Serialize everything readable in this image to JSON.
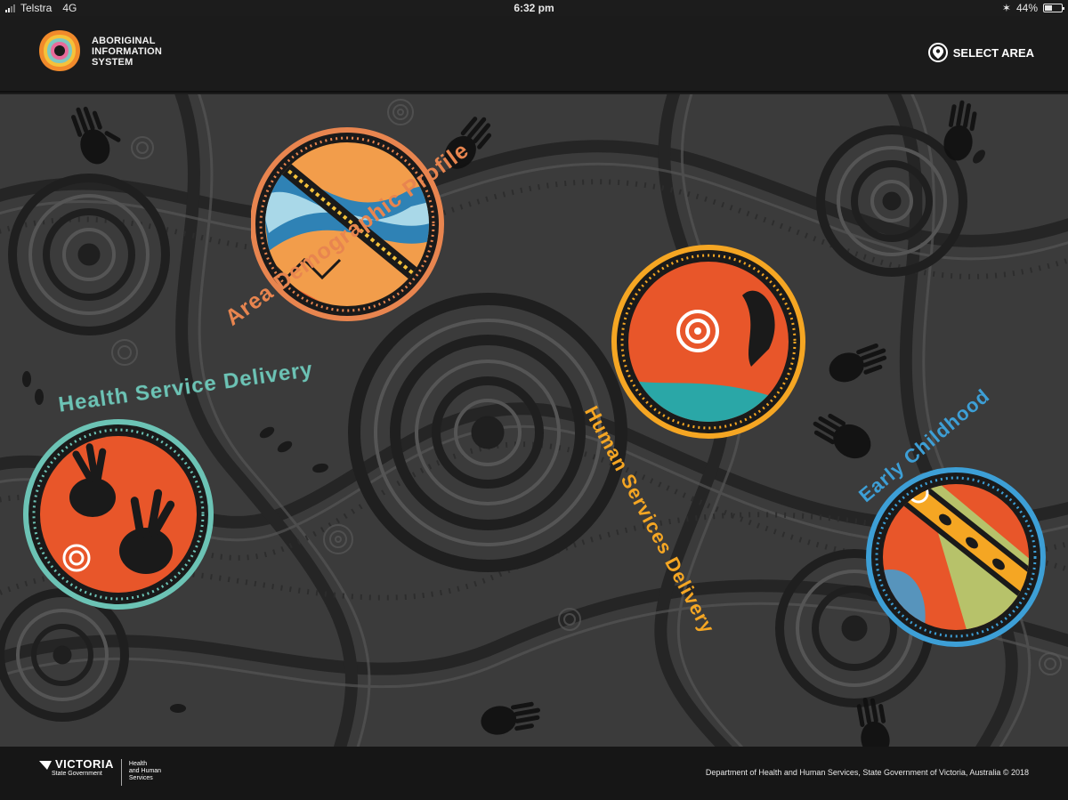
{
  "status_bar": {
    "carrier": "Telstra",
    "network": "4G",
    "time": "6:32 pm",
    "battery": "44%",
    "battery_level": 0.44
  },
  "header": {
    "brand_line1": "ABORIGINAL",
    "brand_line2": "INFORMATION",
    "brand_line3": "SYSTEM",
    "select_area_label": "SELECT AREA"
  },
  "tiles": [
    {
      "label": "Area Demographic Profile",
      "ring_color": "#e8854f"
    },
    {
      "label": "Human Services Delivery",
      "ring_color": "#f5a623"
    },
    {
      "label": "Health Service Delivery",
      "ring_color": "#6cc3b5"
    },
    {
      "label": "Early Childhood",
      "ring_color": "#3d9fd6"
    }
  ],
  "footer": {
    "victoria": "VICTORIA",
    "state_government": "State Government",
    "dhhs_line1": "Health",
    "dhhs_line2": "and Human",
    "dhhs_line3": "Services",
    "copyright": "Department of Health and Human Services, State Government of Victoria, Australia © 2018"
  },
  "colors": {
    "background": "#3a3a3a",
    "header": "#1b1b1b",
    "orange": "#e8562a"
  }
}
